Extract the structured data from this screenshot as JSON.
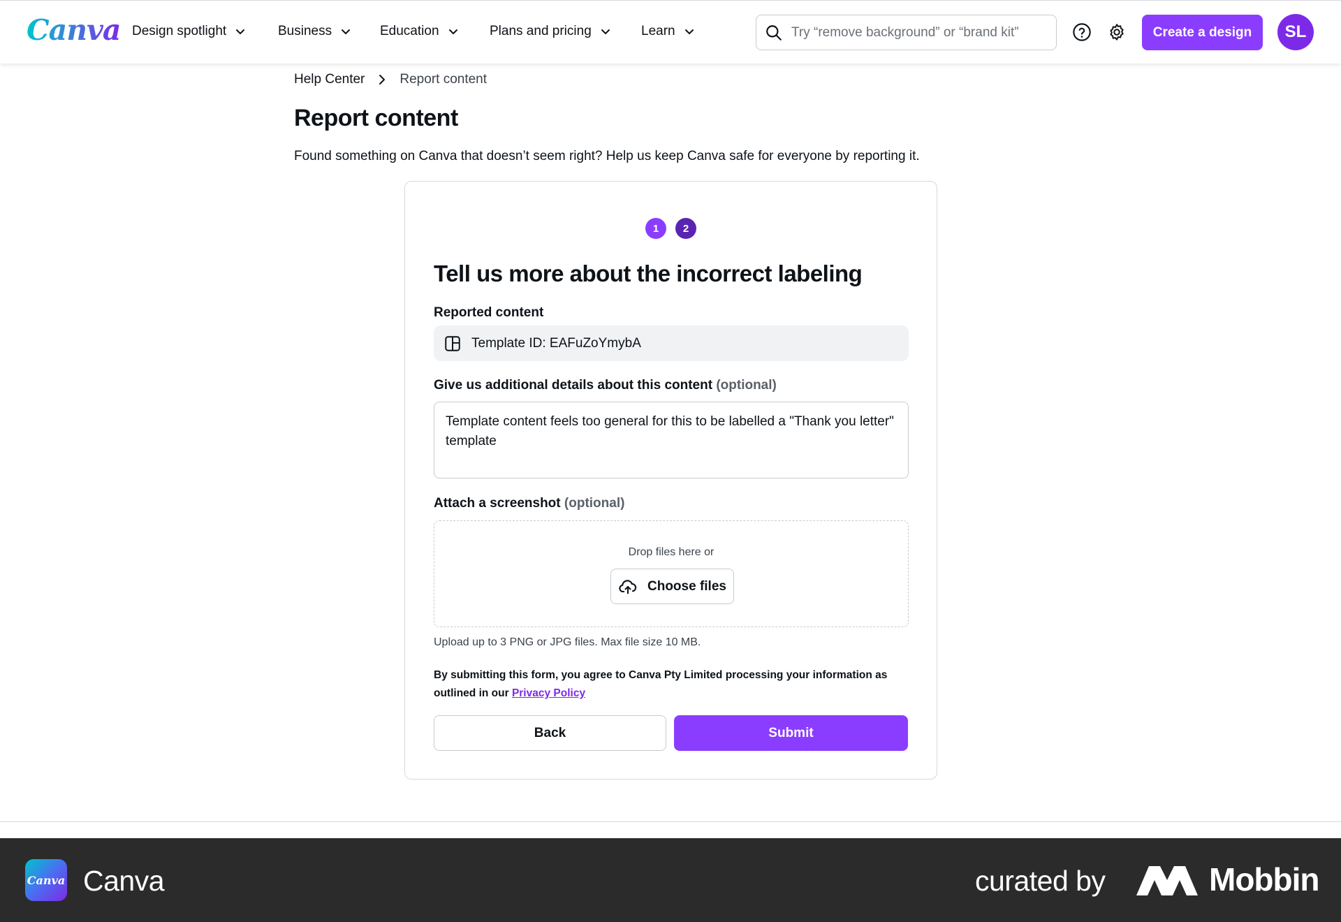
{
  "header": {
    "logo": "Canva",
    "nav": [
      {
        "label": "Design spotlight"
      },
      {
        "label": "Business"
      },
      {
        "label": "Education"
      },
      {
        "label": "Plans and pricing"
      },
      {
        "label": "Learn"
      }
    ],
    "search_placeholder": "Try “remove background” or “brand kit”",
    "create_label": "Create a design",
    "avatar_initials": "SL"
  },
  "breadcrumb": {
    "home": "Help Center",
    "current": "Report content"
  },
  "page": {
    "title": "Report content",
    "intro": "Found something on Canva that doesn’t seem right? Help us keep Canva safe for everyone by reporting it."
  },
  "form": {
    "steps": [
      "1",
      "2"
    ],
    "title": "Tell us more about the incorrect labeling",
    "reported_label": "Reported content",
    "reported_value": "Template ID: EAFuZoYmybA",
    "details_label": "Give us additional details about this content",
    "details_optional": "(optional)",
    "details_value": "Template content feels too general for this to be labelled a \"Thank you letter\" template",
    "attach_label": "Attach a screenshot",
    "attach_optional": "(optional)",
    "drop_text": "Drop files here or",
    "choose_label": "Choose files",
    "upload_note": "Upload up to 3 PNG or JPG files. Max file size 10 MB.",
    "consent_text": "By submitting this form, you agree to Canva Pty Limited processing your information as outlined in our",
    "privacy_link": "Privacy Policy",
    "back_label": "Back",
    "submit_label": "Submit"
  },
  "footer": {
    "icon_text": "Canva",
    "brand": "Canva",
    "curated": "curated by",
    "mobbin": "Mobbin"
  },
  "colors": {
    "accent": "#8b3dff",
    "step_active": "#5a24b3",
    "footer_bg": "#2b2b2b"
  }
}
